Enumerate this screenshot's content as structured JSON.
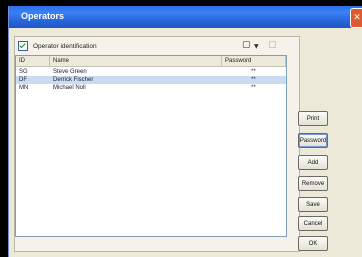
{
  "window": {
    "title": "Operators"
  },
  "options": {
    "identification_label": "Operator identification",
    "identification_checked": true
  },
  "table": {
    "columns": [
      "ID",
      "Name",
      "Password"
    ],
    "rows": [
      {
        "id": "SG",
        "name": "Steve Green",
        "password": "**"
      },
      {
        "id": "DF",
        "name": "Derrick Fischer",
        "password": "**"
      },
      {
        "id": "MN",
        "name": "Michael Noll",
        "password": "**"
      }
    ]
  },
  "buttons": {
    "print": "Print",
    "password": "Password",
    "add": "Add",
    "remove": "Remove",
    "save": "Save",
    "cancel": "Cancel",
    "ok": "OK"
  }
}
